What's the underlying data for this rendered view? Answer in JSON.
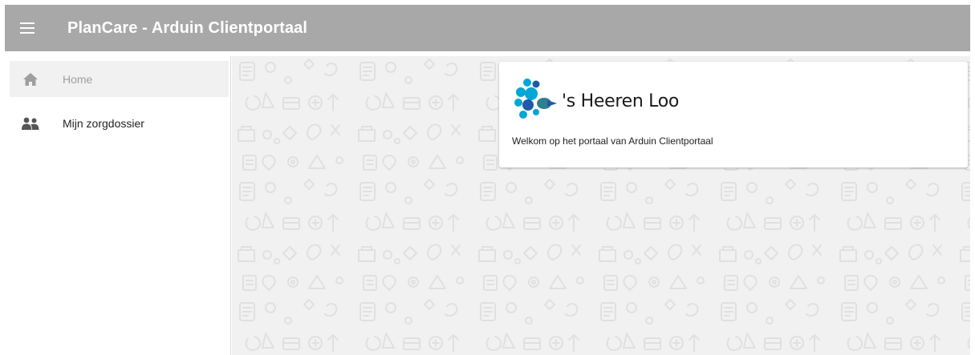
{
  "app": {
    "title": "PlanCare - Arduin Clientportaal"
  },
  "header": {
    "menu_icon": "hamburger-menu-icon",
    "background": "#a8a8a8"
  },
  "sidebar": {
    "items": [
      {
        "label": "Home",
        "icon": "home-icon",
        "active": true
      },
      {
        "label": "Mijn zorgdossier",
        "icon": "people-icon",
        "active": false
      }
    ]
  },
  "welcome_card": {
    "logo_text": "'s Heeren Loo",
    "message": "Welkom op het portaal van Arduin Clientportaal"
  },
  "colors": {
    "logo_blue": "#00a6d6",
    "logo_dark_blue": "#1e5aa8",
    "logo_teal": "#2f7f8c",
    "content_background": "#f1f1f1"
  }
}
